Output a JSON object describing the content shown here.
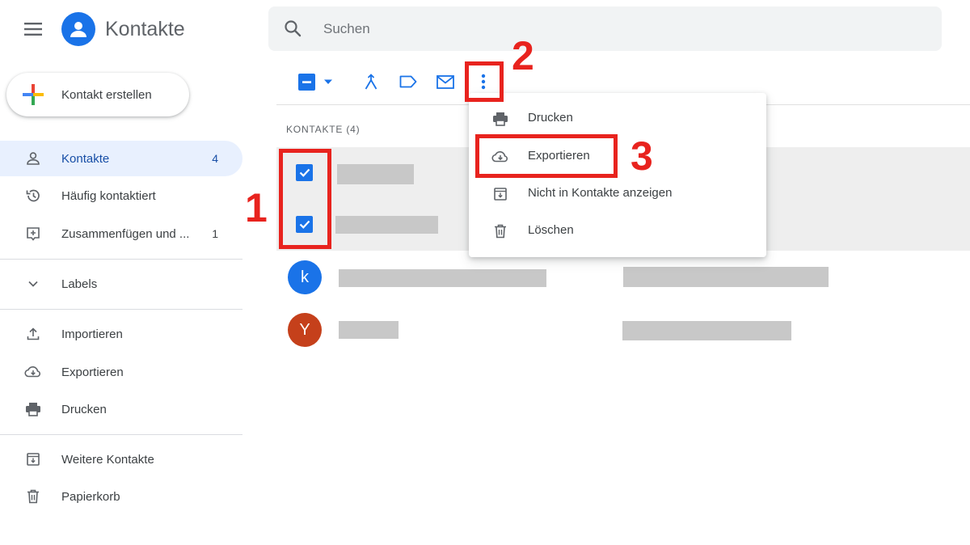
{
  "header": {
    "app_title": "Kontakte"
  },
  "search": {
    "placeholder": "Suchen"
  },
  "create_button": {
    "label": "Kontakt erstellen"
  },
  "sidebar": {
    "items": [
      {
        "label": "Kontakte",
        "count": "4",
        "icon": "person-icon",
        "active": true
      },
      {
        "label": "Häufig kontaktiert",
        "icon": "history-icon"
      },
      {
        "label": "Zusammenfügen und ...",
        "count": "1",
        "icon": "merge-box-icon"
      },
      {
        "label": "Labels",
        "icon": "chevron-down-icon"
      },
      {
        "label": "Importieren",
        "icon": "upload-icon"
      },
      {
        "label": "Exportieren",
        "icon": "cloud-download-icon"
      },
      {
        "label": "Drucken",
        "icon": "print-icon"
      },
      {
        "label": "Weitere Kontakte",
        "icon": "archive-icon"
      },
      {
        "label": "Papierkorb",
        "icon": "trash-icon"
      }
    ]
  },
  "list": {
    "section_header": "KONTAKTE (4)"
  },
  "contacts": [
    {
      "selected": true,
      "avatar_letter": ""
    },
    {
      "selected": true,
      "avatar_letter": ""
    },
    {
      "selected": false,
      "avatar_letter": "k",
      "avatar_color": "#1a73e8"
    },
    {
      "selected": false,
      "avatar_letter": "Y",
      "avatar_color": "#c5401b"
    }
  ],
  "more_menu": {
    "items": [
      {
        "label": "Drucken",
        "icon": "print-icon"
      },
      {
        "label": "Exportieren",
        "icon": "cloud-download-icon"
      },
      {
        "label": "Nicht in Kontakte anzeigen",
        "icon": "archive-icon"
      },
      {
        "label": "Löschen",
        "icon": "trash-icon"
      }
    ]
  },
  "annotations": {
    "step1": "1",
    "step2": "2",
    "step3": "3"
  },
  "colors": {
    "accent": "#1a73e8",
    "annotation": "#e8231e",
    "selected_row": "#eeeeee",
    "placeholder_bar": "#c8c8c8"
  }
}
